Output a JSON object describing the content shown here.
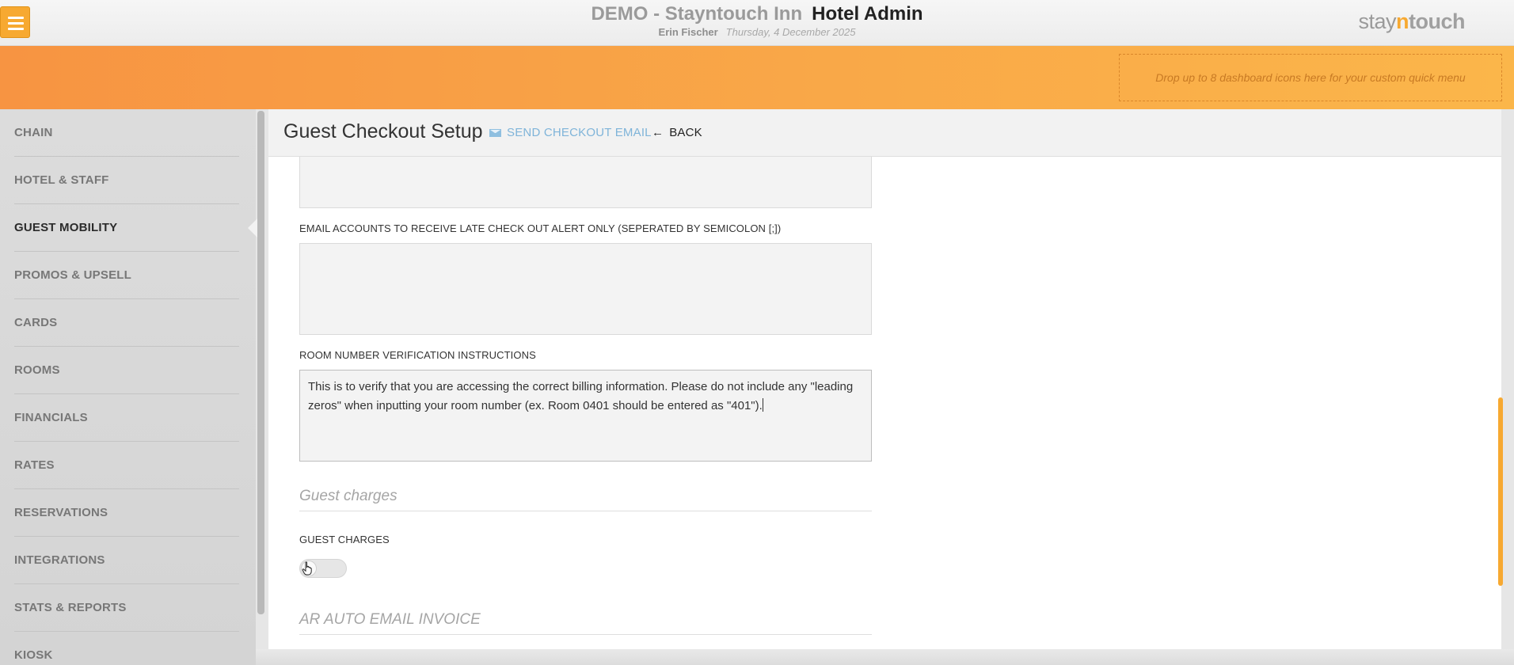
{
  "header": {
    "property_name": "DEMO - Stayntouch Inn",
    "app_name": "Hotel Admin",
    "user_name": "Erin Fischer",
    "date": "Thursday, 4 December 2025",
    "logo": {
      "part1": "stay",
      "part2": "n",
      "part3": "touch"
    }
  },
  "quick_menu": {
    "placeholder": "Drop up to 8 dashboard icons here for your custom quick menu"
  },
  "sidebar": {
    "items": [
      {
        "label": "CHAIN"
      },
      {
        "label": "HOTEL & STAFF"
      },
      {
        "label": "GUEST MOBILITY"
      },
      {
        "label": "PROMOS & UPSELL"
      },
      {
        "label": "CARDS"
      },
      {
        "label": "ROOMS"
      },
      {
        "label": "FINANCIALS"
      },
      {
        "label": "RATES"
      },
      {
        "label": "RESERVATIONS"
      },
      {
        "label": "INTEGRATIONS"
      },
      {
        "label": "STATS & REPORTS"
      },
      {
        "label": "KIOSK"
      }
    ],
    "active_index": 2
  },
  "page": {
    "title": "Guest Checkout Setup",
    "send_email_label": "SEND CHECKOUT EMAIL",
    "back_label": "BACK"
  },
  "form": {
    "previous_field_value": "",
    "late_checkout_label": "EMAIL ACCOUNTS TO RECEIVE LATE CHECK OUT ALERT ONLY (SEPERATED BY SEMICOLON [;])",
    "late_checkout_value": "",
    "room_verification_label": "ROOM NUMBER VERIFICATION INSTRUCTIONS",
    "room_verification_value": "This is to verify that you are accessing the correct billing information.  Please do not include any \"leading zeros\" when inputting your room number (ex. Room 0401 should be entered as \"401\").",
    "guest_charges_section": "Guest charges",
    "guest_charges_label": "GUEST CHARGES",
    "guest_charges_enabled": false,
    "ar_section": "AR AUTO EMAIL INVOICE"
  },
  "colors": {
    "accent": "#f7a931",
    "link": "#7fb4d9"
  }
}
